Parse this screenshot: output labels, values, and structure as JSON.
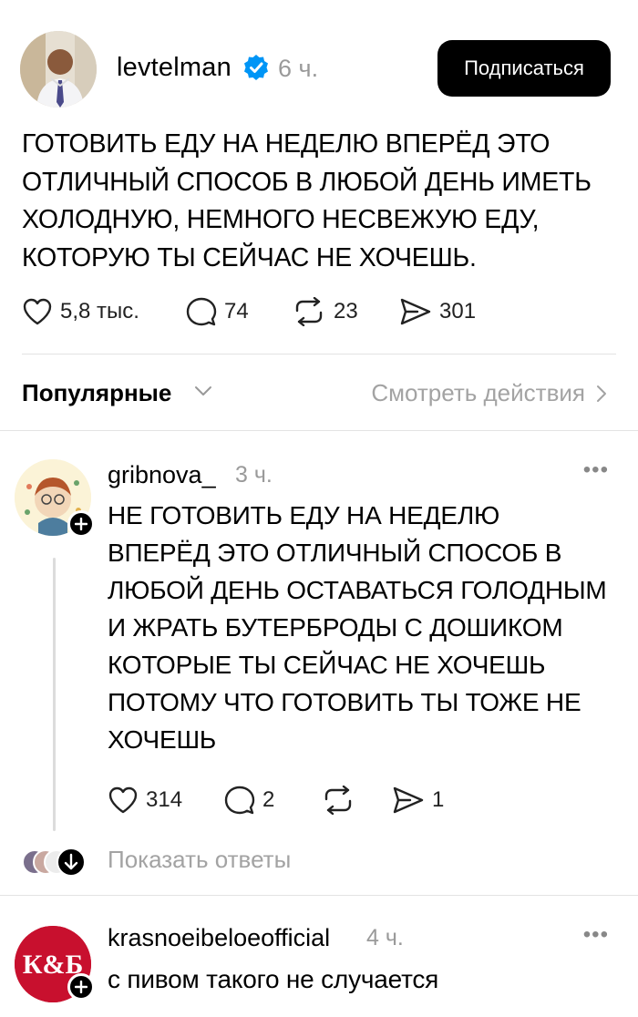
{
  "post": {
    "username": "levtelman",
    "time": "6 ч.",
    "subscribe_label": "Подписаться",
    "text": "ГОТОВИТЬ ЕДУ НА НЕДЕЛЮ ВПЕРЁД ЭТО ОТЛИЧНЫЙ СПОСОБ В ЛЮБОЙ ДЕНЬ ИМЕТЬ ХОЛОДНУЮ, НЕМНОГО НЕСВЕЖУЮ ЕДУ, КОТОРУЮ ТЫ СЕЙЧАС НЕ ХОЧЕШЬ.",
    "likes": "5,8 тыс.",
    "comments": "74",
    "reposts": "23",
    "shares": "301"
  },
  "sort": {
    "label": "Популярные",
    "view_actions": "Смотреть действия"
  },
  "replies": [
    {
      "username": "gribnova_",
      "time": "3 ч.",
      "text": "НЕ ГОТОВИТЬ ЕДУ НА НЕДЕЛЮ ВПЕРЁД ЭТО ОТЛИЧНЫЙ СПОСОБ В ЛЮБОЙ ДЕНЬ ОСТАВАТЬСЯ ГОЛОДНЫМ И ЖРАТЬ БУТЕРБРОДЫ С ДОШИКОМ КОТОРЫЕ ТЫ СЕЙЧАС НЕ ХОЧЕШЬ ПОТОМУ ЧТО ГОТОВИТЬ ТЫ ТОЖЕ НЕ ХОЧЕШЬ",
      "likes": "314",
      "comments": "2",
      "shares": "1",
      "show_replies": "Показать ответы"
    },
    {
      "username": "krasnoeibeloeofficial",
      "time": "4 ч.",
      "text": "с пивом такого не случается",
      "avatar_logo": "К&Б"
    }
  ],
  "icons": {
    "verified": "verified-badge-icon",
    "like": "heart-icon",
    "comment": "comment-bubble-icon",
    "repost": "repost-icon",
    "share": "share-send-icon",
    "more": "more-dots-icon",
    "plus": "plus-icon",
    "chevron": "chevron-down-icon"
  },
  "colors": {
    "verified_blue": "#0095f6",
    "kb_red": "#c8102e",
    "muted_text": "#9a9a9a"
  }
}
